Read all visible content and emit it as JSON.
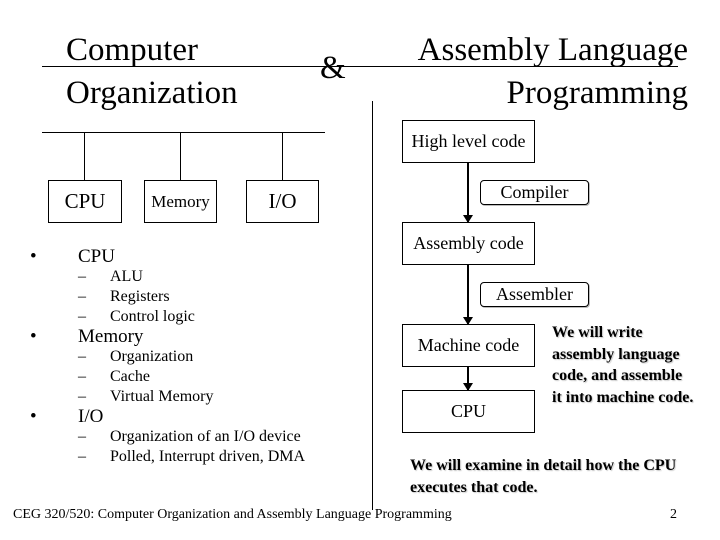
{
  "slide": {
    "title_left": {
      "line1": "Computer",
      "line2": "Organization"
    },
    "ampersand": "&",
    "title_right": {
      "line1": "Assembly Language",
      "line2": "Programming"
    }
  },
  "diagram_left": {
    "boxes": [
      {
        "label": "CPU"
      },
      {
        "label": "Memory"
      },
      {
        "label": "I/O"
      }
    ]
  },
  "bullets": [
    {
      "label": "CPU",
      "bullet": "•",
      "subitems": [
        "ALU",
        "Registers",
        "Control logic"
      ]
    },
    {
      "label": "Memory",
      "bullet": "•",
      "subitems": [
        "Organization",
        "Cache",
        "Virtual Memory"
      ]
    },
    {
      "label": "I/O",
      "bullet": "•",
      "subitems": [
        "Organization of an I/O device",
        "Polled, Interrupt driven, DMA"
      ]
    }
  ],
  "dash": "–",
  "flow": {
    "stages": [
      {
        "label": "High level code"
      },
      {
        "label": "Assembly code"
      },
      {
        "label": "Machine code"
      },
      {
        "label": "CPU"
      }
    ],
    "tools": [
      {
        "label": "Compiler"
      },
      {
        "label": "Assembler"
      }
    ]
  },
  "notes": {
    "write_note": [
      "We will write",
      "assembly language",
      "code, and assemble",
      "it into machine code."
    ],
    "examine_note": [
      "We will examine in detail how the CPU",
      "executes that code."
    ]
  },
  "footer": {
    "course": "CEG 320/520: Computer Organization and Assembly Language Programming",
    "page_number": "2"
  }
}
